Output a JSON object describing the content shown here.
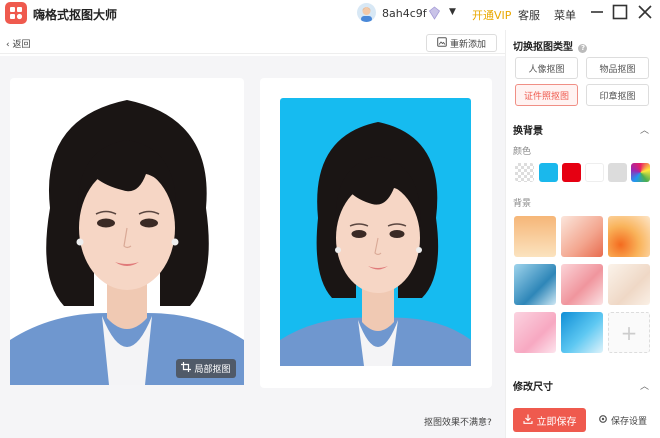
{
  "app": {
    "title": "嗨格式抠图大师"
  },
  "user": {
    "name": "8ah4c9f",
    "vip_label": "开通VIP",
    "service_label": "客服",
    "menu_label": "菜单"
  },
  "toolbar": {
    "back_label": "返回",
    "readd_label": "重新添加"
  },
  "canvas": {
    "local_cut_label": "局部抠图",
    "unsatisfied_label": "抠图效果不满意?"
  },
  "panel": {
    "type_title": "切换抠图类型",
    "types": [
      "人像抠图",
      "物品抠图",
      "证件照抠图",
      "印章抠图"
    ],
    "active_type": "证件照抠图",
    "bg_title": "换背景",
    "color_label": "颜色",
    "colors": [
      "transparent",
      "#1ab8ec",
      "#e60012",
      "#ffffff",
      "#dcdcdc",
      "rainbow"
    ],
    "background_label": "背景",
    "resize_title": "修改尺寸",
    "save_label": "立即保存",
    "settings_label": "保存设置"
  },
  "colors": {
    "accent": "#ef5a4e",
    "vip": "#e9a800",
    "photo_bg": "#16bbf0"
  }
}
